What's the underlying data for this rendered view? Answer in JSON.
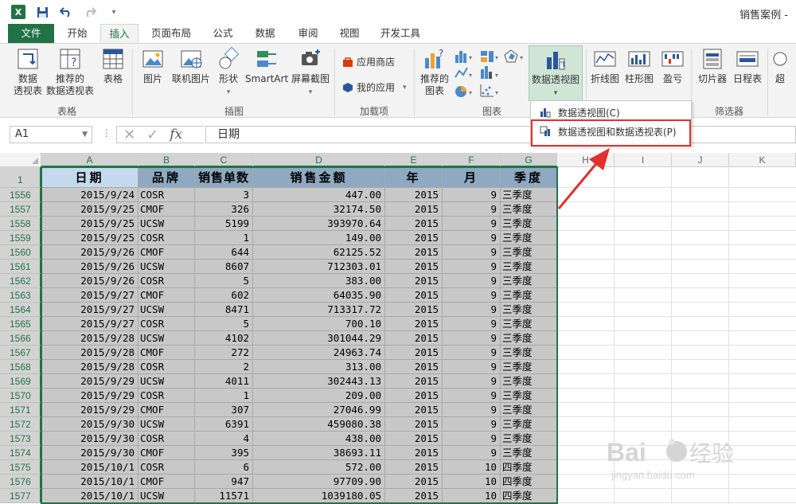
{
  "title_bar": {
    "doc_title": "销售案例 -",
    "logo": "X"
  },
  "tabs": [
    "文件",
    "开始",
    "插入",
    "页面布局",
    "公式",
    "数据",
    "审阅",
    "视图",
    "开发工具"
  ],
  "ribbon": {
    "pivot_table": "数据\n透视表",
    "recommended_pivot": "推荐的\n数据透视表",
    "table": "表格",
    "group_tables": "表格",
    "picture": "图片",
    "online_picture": "联机图片",
    "shapes": "形状",
    "smartart": "SmartArt",
    "screenshot": "屏幕截图",
    "group_illustrations": "插图",
    "store": "应用商店",
    "my_apps": "我的应用",
    "group_addins": "加载项",
    "recommended_charts": "推荐的\n图表",
    "group_charts": "图表",
    "pivot_chart": "数据透视图",
    "line": "折线图",
    "column": "柱形图",
    "winloss": "盈亏",
    "slicer": "切片器",
    "timeline": "日程表",
    "group_filters": "筛选器",
    "hyperlink_partial": "超"
  },
  "dropdown": {
    "item1": "数据透视图(C)",
    "item2": "数据透视图和数据透视表(P)"
  },
  "formula_bar": {
    "name_box": "A1",
    "value": "日期"
  },
  "columns": [
    "A",
    "B",
    "C",
    "D",
    "E",
    "F",
    "G",
    "H",
    "I",
    "J",
    "K"
  ],
  "header_row_number": "1",
  "header": [
    "日期",
    "品牌",
    "销售单数",
    "销售金额",
    "年",
    "月",
    "季度"
  ],
  "rows": [
    {
      "n": "1556",
      "c": [
        "2015/9/24",
        "COSR",
        "3",
        "447.00",
        "2015",
        "9",
        "三季度"
      ]
    },
    {
      "n": "1557",
      "c": [
        "2015/9/25",
        "CMOF",
        "326",
        "32174.50",
        "2015",
        "9",
        "三季度"
      ]
    },
    {
      "n": "1558",
      "c": [
        "2015/9/25",
        "UCSW",
        "5199",
        "393970.64",
        "2015",
        "9",
        "三季度"
      ]
    },
    {
      "n": "1559",
      "c": [
        "2015/9/25",
        "COSR",
        "1",
        "149.00",
        "2015",
        "9",
        "三季度"
      ]
    },
    {
      "n": "1560",
      "c": [
        "2015/9/26",
        "CMOF",
        "644",
        "62125.52",
        "2015",
        "9",
        "三季度"
      ]
    },
    {
      "n": "1561",
      "c": [
        "2015/9/26",
        "UCSW",
        "8607",
        "712303.01",
        "2015",
        "9",
        "三季度"
      ]
    },
    {
      "n": "1562",
      "c": [
        "2015/9/26",
        "COSR",
        "5",
        "383.00",
        "2015",
        "9",
        "三季度"
      ]
    },
    {
      "n": "1563",
      "c": [
        "2015/9/27",
        "CMOF",
        "602",
        "64035.90",
        "2015",
        "9",
        "三季度"
      ]
    },
    {
      "n": "1564",
      "c": [
        "2015/9/27",
        "UCSW",
        "8471",
        "713317.72",
        "2015",
        "9",
        "三季度"
      ]
    },
    {
      "n": "1565",
      "c": [
        "2015/9/27",
        "COSR",
        "5",
        "700.10",
        "2015",
        "9",
        "三季度"
      ]
    },
    {
      "n": "1566",
      "c": [
        "2015/9/28",
        "UCSW",
        "4102",
        "301044.29",
        "2015",
        "9",
        "三季度"
      ]
    },
    {
      "n": "1567",
      "c": [
        "2015/9/28",
        "CMOF",
        "272",
        "24963.74",
        "2015",
        "9",
        "三季度"
      ]
    },
    {
      "n": "1568",
      "c": [
        "2015/9/28",
        "COSR",
        "2",
        "313.00",
        "2015",
        "9",
        "三季度"
      ]
    },
    {
      "n": "1569",
      "c": [
        "2015/9/29",
        "UCSW",
        "4011",
        "302443.13",
        "2015",
        "9",
        "三季度"
      ]
    },
    {
      "n": "1570",
      "c": [
        "2015/9/29",
        "COSR",
        "1",
        "209.00",
        "2015",
        "9",
        "三季度"
      ]
    },
    {
      "n": "1571",
      "c": [
        "2015/9/29",
        "CMOF",
        "307",
        "27046.99",
        "2015",
        "9",
        "三季度"
      ]
    },
    {
      "n": "1572",
      "c": [
        "2015/9/30",
        "UCSW",
        "6391",
        "459080.38",
        "2015",
        "9",
        "三季度"
      ]
    },
    {
      "n": "1573",
      "c": [
        "2015/9/30",
        "COSR",
        "4",
        "438.00",
        "2015",
        "9",
        "三季度"
      ]
    },
    {
      "n": "1574",
      "c": [
        "2015/9/30",
        "CMOF",
        "395",
        "38693.11",
        "2015",
        "9",
        "三季度"
      ]
    },
    {
      "n": "1575",
      "c": [
        "2015/10/1",
        "COSR",
        "6",
        "572.00",
        "2015",
        "10",
        "四季度"
      ]
    },
    {
      "n": "1576",
      "c": [
        "2015/10/1",
        "CMOF",
        "947",
        "97709.90",
        "2015",
        "10",
        "四季度"
      ]
    },
    {
      "n": "1577",
      "c": [
        "2015/10/1",
        "UCSW",
        "11571",
        "1039180.05",
        "2015",
        "10",
        "四季度"
      ]
    }
  ],
  "watermark": {
    "brand": "Bai",
    "brand2": "经验",
    "url": "jingyan.baidu.com"
  },
  "colors": {
    "excel_green": "#217346",
    "header_fill": "#8ea9c1",
    "a1_fill": "#c5d9ee",
    "cell_fill": "#c8c8c8",
    "highlight_red": "#e0302f"
  }
}
